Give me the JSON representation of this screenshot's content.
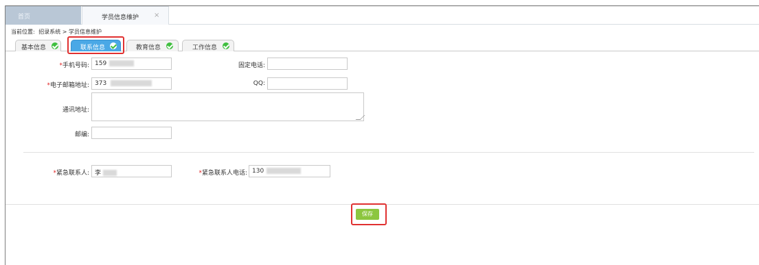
{
  "window": {
    "tabs": [
      {
        "label": "首页"
      },
      {
        "label": "学员信息维护",
        "close": "×"
      }
    ]
  },
  "breadcrumb": {
    "prefix": "当前位置:",
    "path": "招录系统 > 学员信息维护"
  },
  "subtabs": [
    {
      "label": "基本信息",
      "active": false,
      "status": "check-icon"
    },
    {
      "label": "联系信息",
      "active": true,
      "status": "check-icon"
    },
    {
      "label": "教育信息",
      "active": false,
      "status": "check-icon"
    },
    {
      "label": "工作信息",
      "active": false,
      "status": "check-icon"
    }
  ],
  "form": {
    "mobile": {
      "label": "手机号码:",
      "required_mark": "*",
      "value": "159"
    },
    "landline": {
      "label": "固定电话:",
      "value": ""
    },
    "email": {
      "label": "电子邮箱地址:",
      "required_mark": "*",
      "value": "373"
    },
    "qq": {
      "label": "QQ:",
      "value": ""
    },
    "address": {
      "label": "通讯地址:",
      "value": ""
    },
    "postcode": {
      "label": "邮编:",
      "value": ""
    },
    "emergency_contact": {
      "label": "紧急联系人:",
      "required_mark": "*",
      "value": "李"
    },
    "emergency_phone": {
      "label": "紧急联系人电话:",
      "required_mark": "*",
      "value": "130"
    }
  },
  "actions": {
    "save_label": "保存"
  },
  "colors": {
    "active_tab": "#4aa8e6",
    "check": "#3fbf3f",
    "save_button": "#8cc63f",
    "highlight": "#e03030",
    "required": "#e02020"
  }
}
